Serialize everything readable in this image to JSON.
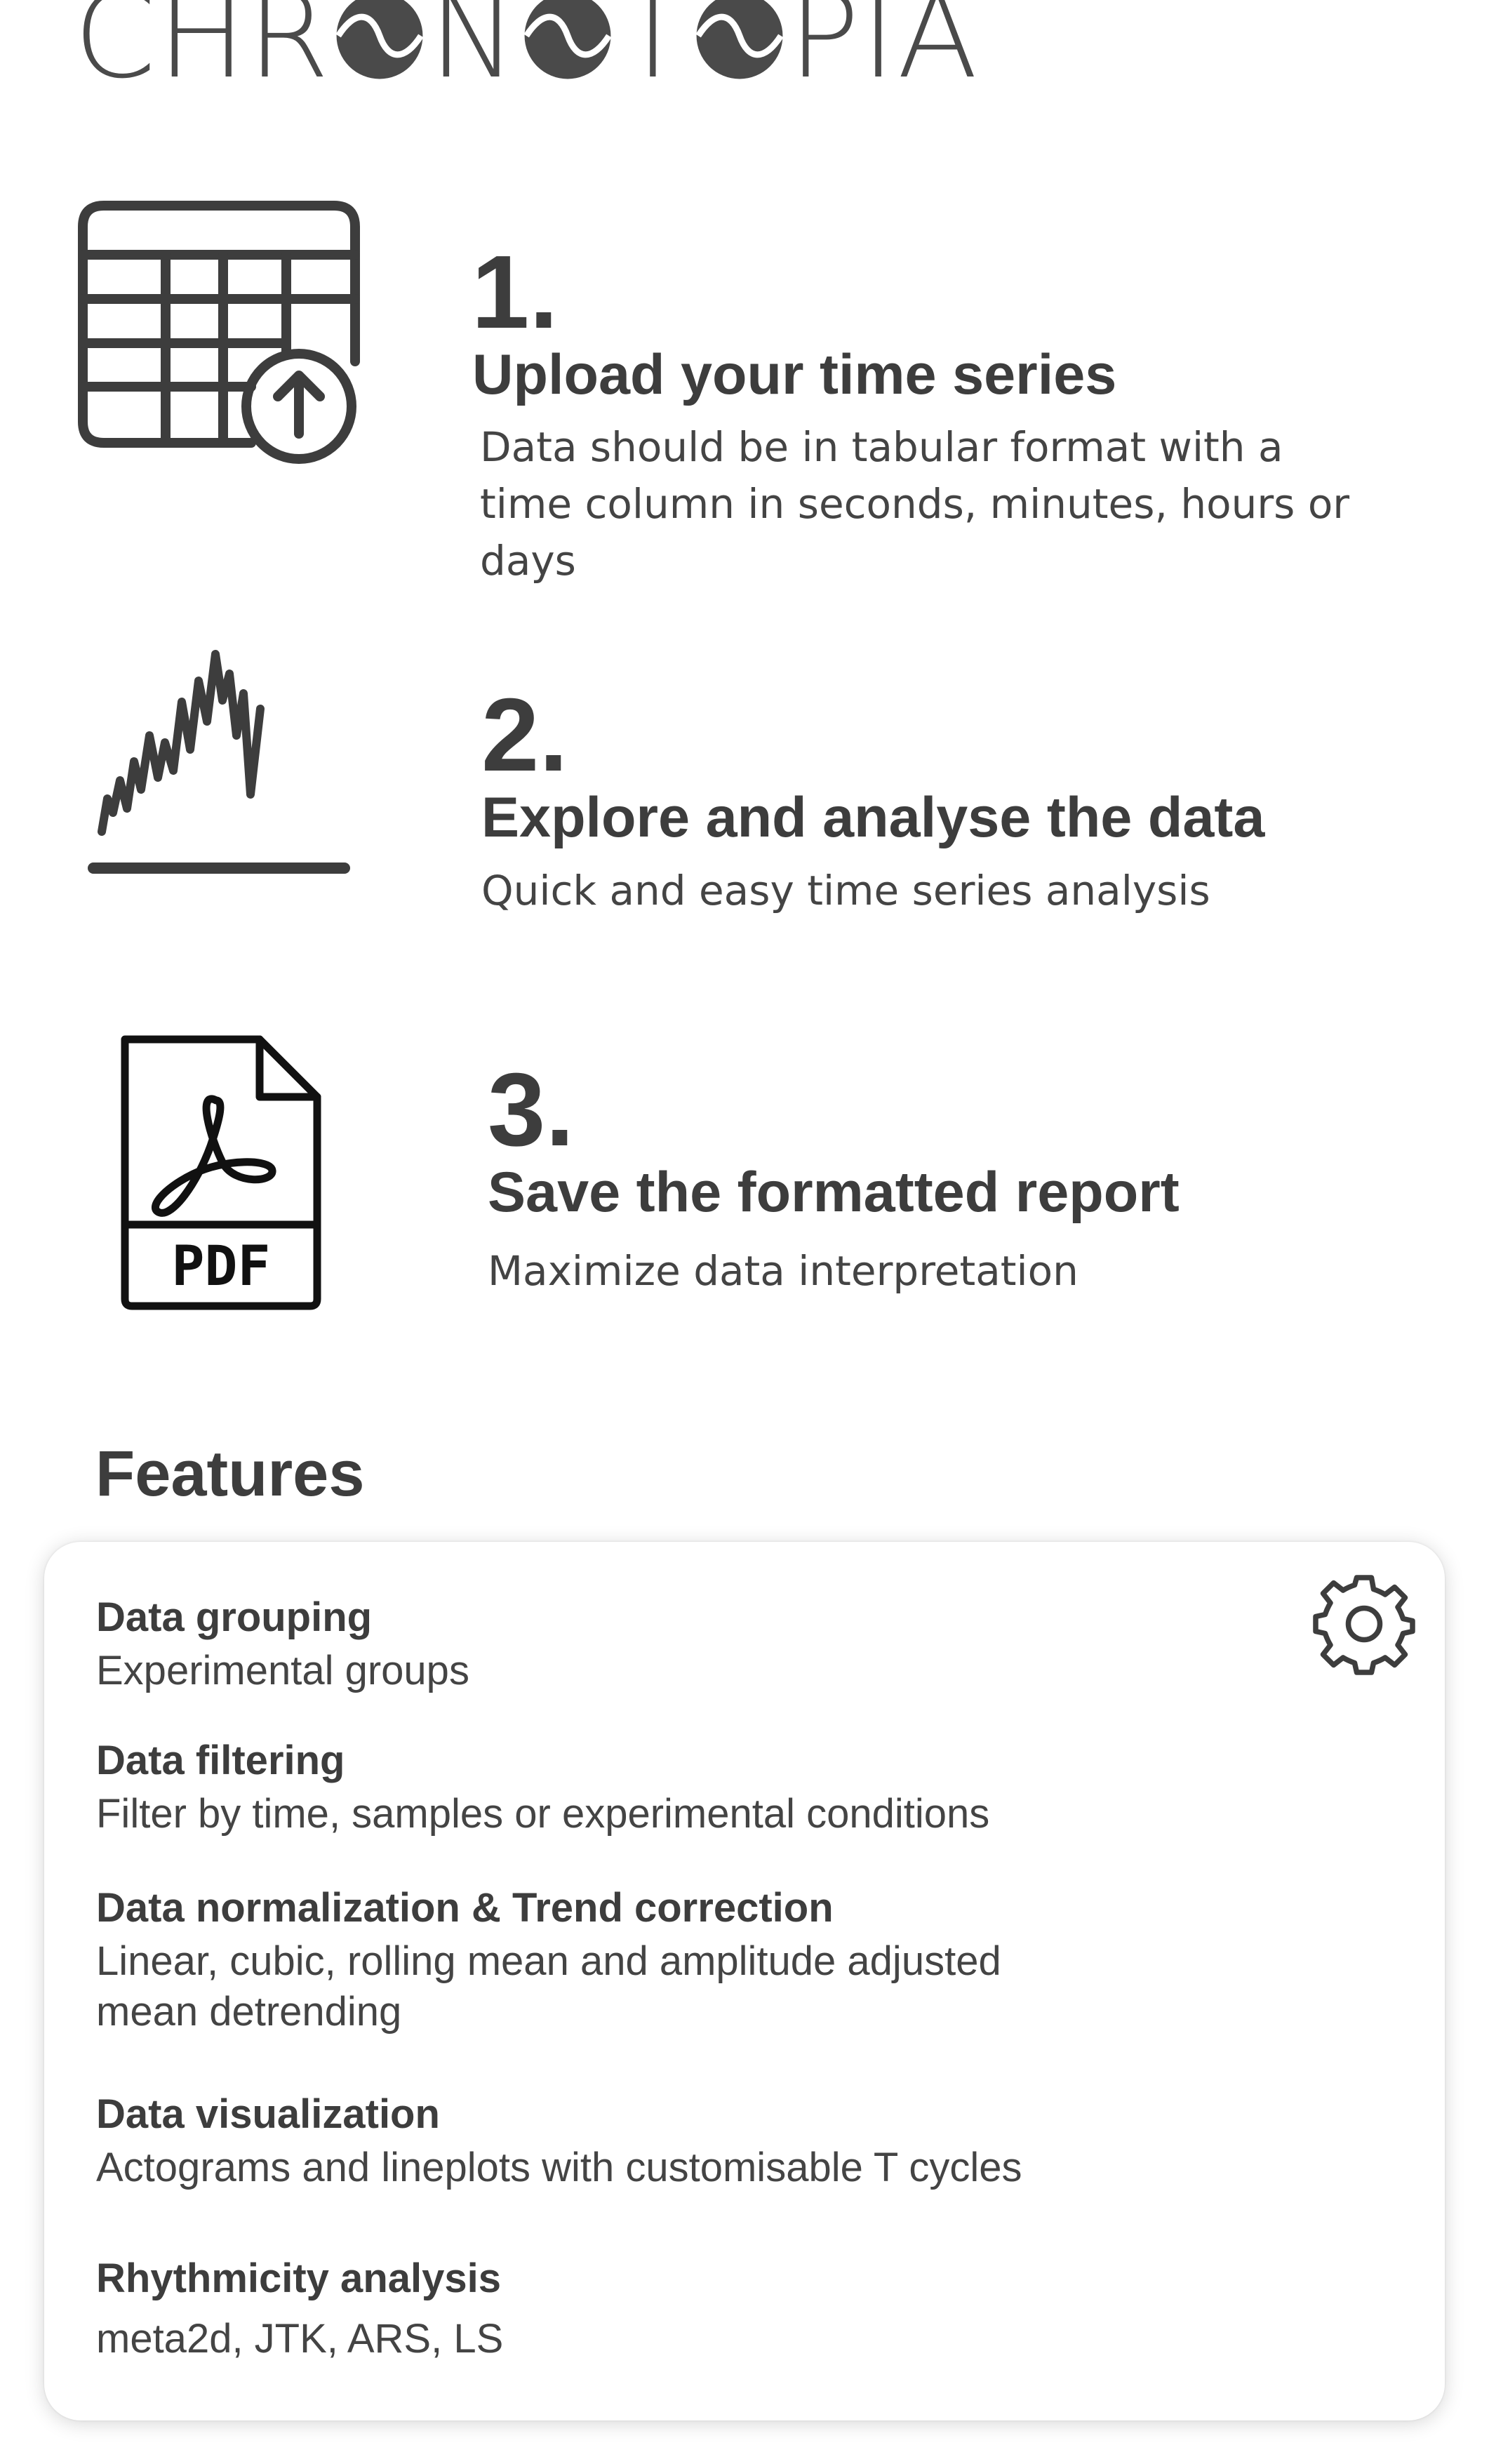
{
  "logo": {
    "prefix": "CHR",
    "middle1": "N",
    "middle2": "T",
    "suffix": "PIA",
    "o_icon": "half-moon-wave-icon"
  },
  "steps": [
    {
      "number": "1.",
      "title": "Upload your time series",
      "desc": "Data should be in tabular format with a time column in seconds, minutes, hours or days",
      "icon": "table-upload-icon"
    },
    {
      "number": "2.",
      "title": "Explore and analyse the data",
      "desc": "Quick and easy time series analysis",
      "icon": "line-chart-icon"
    },
    {
      "number": "3.",
      "title": "Save the formatted report",
      "desc": "Maximize data interpretation",
      "icon": "pdf-file-icon",
      "icon_label": "PDF"
    }
  ],
  "features": {
    "heading": "Features",
    "icon": "gear-icon",
    "items": [
      {
        "title": "Data grouping",
        "desc": "Experimental groups"
      },
      {
        "title": "Data filtering",
        "desc": "Filter by time, samples or experimental conditions"
      },
      {
        "title": "Data normalization & Trend correction",
        "desc": "Linear, cubic, rolling mean and amplitude adjusted mean detrending"
      },
      {
        "title": "Data visualization",
        "desc": "Actograms and lineplots with customisable T cycles"
      },
      {
        "title": "Rhythmicity analysis",
        "desc": "meta2d, JTK, ARS, LS"
      }
    ]
  },
  "colors": {
    "text": "#3d3d3d",
    "icon": "#3d3d3d",
    "background": "#ffffff"
  }
}
